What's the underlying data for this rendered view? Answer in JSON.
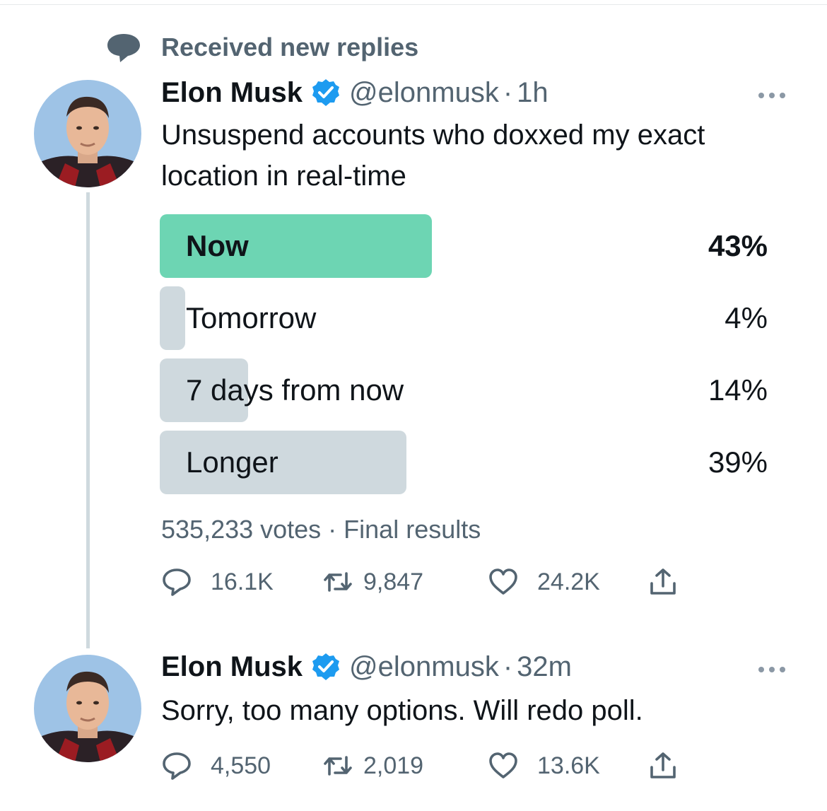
{
  "context": {
    "text": "Received new replies",
    "icon": "speech-bubble-icon"
  },
  "colors": {
    "verified": "#1d9bf0",
    "winner_fill": "#6dd5b3",
    "option_fill": "#cfd9de",
    "secondary_text": "#536471"
  },
  "tweets": [
    {
      "name": "Elon Musk",
      "handle": "@elonmusk",
      "separator": "·",
      "time": "1h",
      "text": "Unsuspend accounts who doxxed my exact location in real-time",
      "poll": {
        "options": [
          {
            "label": "Now",
            "percent_text": "43%",
            "percent": 43,
            "winner": true
          },
          {
            "label": "Tomorrow",
            "percent_text": "4%",
            "percent": 4,
            "winner": false
          },
          {
            "label": "7 days from now",
            "percent_text": "14%",
            "percent": 14,
            "winner": false
          },
          {
            "label": "Longer",
            "percent_text": "39%",
            "percent": 39,
            "winner": false
          }
        ],
        "meta": "535,233 votes · Final results"
      },
      "stats": {
        "replies": "16.1K",
        "retweets": "9,847",
        "likes": "24.2K"
      }
    },
    {
      "name": "Elon Musk",
      "handle": "@elonmusk",
      "separator": "·",
      "time": "32m",
      "text": "Sorry, too many options. Will redo poll.",
      "stats": {
        "replies": "4,550",
        "retweets": "2,019",
        "likes": "13.6K"
      }
    }
  ]
}
